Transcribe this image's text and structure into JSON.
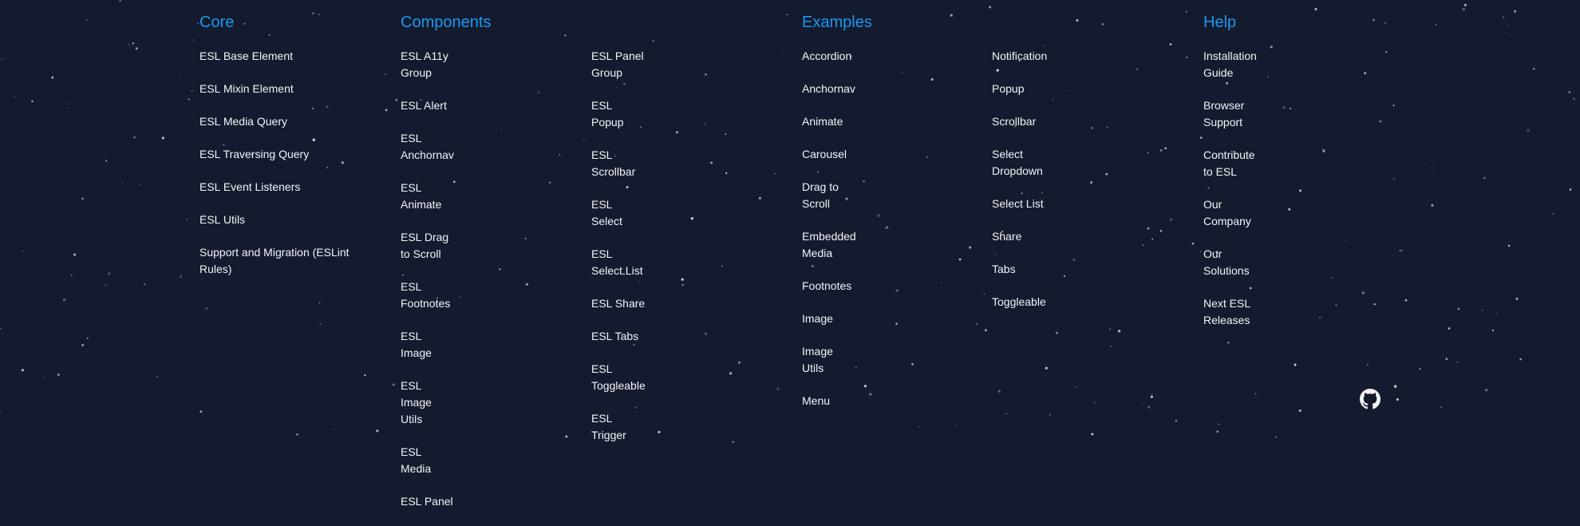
{
  "footer": {
    "core": {
      "title": "Core",
      "links": [
        "ESL Base Element",
        "ESL Mixin Element",
        "ESL Media Query",
        "ESL Traversing Query",
        "ESL Event Listeners",
        "ESL Utils",
        "Support and Migration (ESLint Rules)"
      ]
    },
    "components": {
      "title": "Components",
      "links_a": [
        "ESL A11y Group",
        "ESL Alert",
        "ESL Anchornav",
        "ESL Animate",
        "ESL Drag to Scroll",
        "ESL Footnotes",
        "ESL Image",
        "ESL Image Utils",
        "ESL Media",
        "ESL Panel"
      ],
      "links_b": [
        "ESL Panel Group",
        "ESL Popup",
        "ESL Scrollbar",
        "ESL Select",
        "ESL Select List",
        "ESL Share",
        "ESL Tabs",
        "ESL Toggleable",
        "ESL Trigger"
      ]
    },
    "examples": {
      "title": "Examples",
      "links_a": [
        "Accordion",
        "Anchornav",
        "Animate",
        "Carousel",
        "Drag to Scroll",
        "Embedded Media",
        "Footnotes",
        "Image",
        "Image Utils",
        "Menu"
      ],
      "links_b": [
        "Notification",
        "Popup",
        "Scrollbar",
        "Select Dropdown",
        "Select List",
        "Share",
        "Tabs",
        "Toggleable"
      ]
    },
    "help": {
      "title": "Help",
      "links": [
        "Installation Guide",
        "Browser Support",
        "Contribute to ESL",
        "Our Company",
        "Our Solutions",
        "Next ESL Releases"
      ]
    },
    "github_icon": "github-icon"
  },
  "colors": {
    "background": "#141b2e",
    "heading": "#1a98ef",
    "link": "#f2f4f8",
    "star": "#ffffff"
  }
}
